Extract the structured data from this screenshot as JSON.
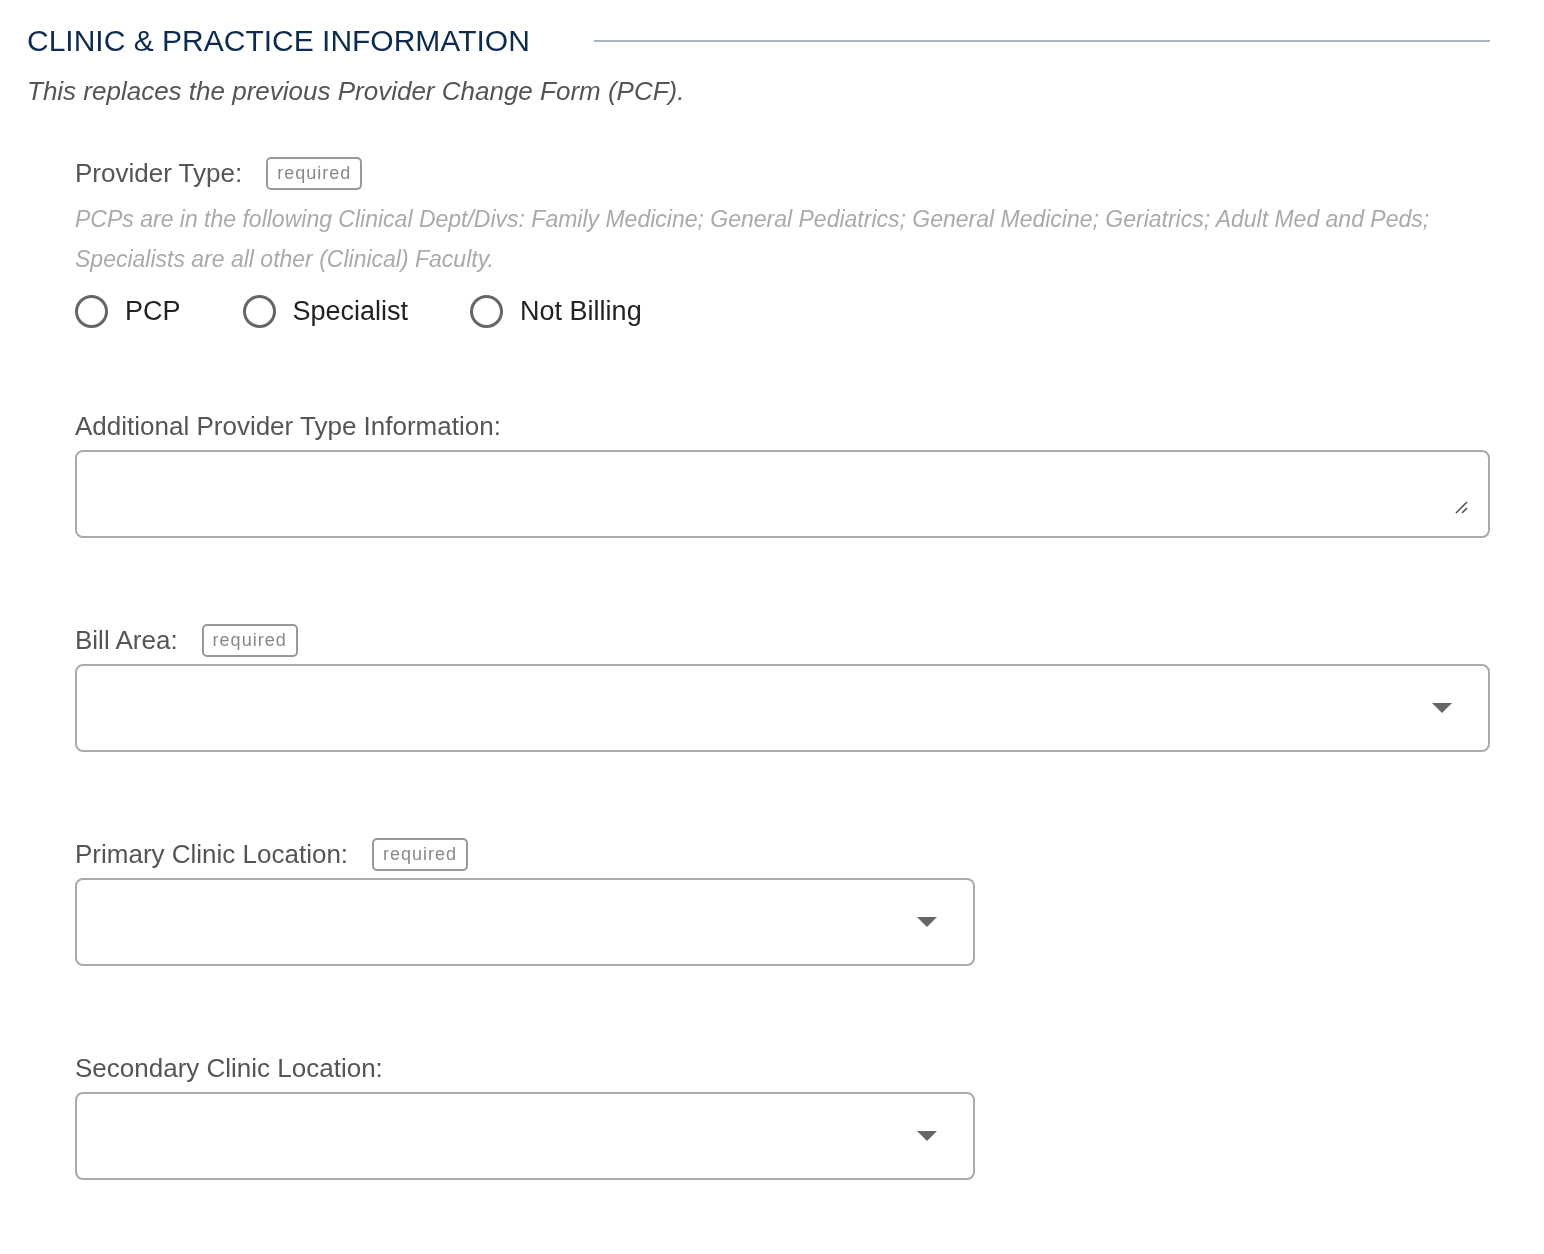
{
  "section": {
    "title": "CLINIC & PRACTICE INFORMATION",
    "subtitle": "This replaces the previous Provider Change Form (PCF)."
  },
  "fields": [
    {
      "kind": "radio",
      "label": "Provider Type:",
      "badge": "required",
      "help": "PCPs are in the following Clinical Dept/Divs: Family Medicine; General Pediatrics; General Medicine; Geriatrics; Adult Med and Peds; Specialists are all other (Clinical) Faculty.",
      "options": [
        {
          "label": "PCP",
          "selected": false
        },
        {
          "label": "Specialist",
          "selected": false
        },
        {
          "label": "Not Billing",
          "selected": false
        }
      ]
    },
    {
      "kind": "textarea",
      "label": "Additional Provider Type Information:"
    },
    {
      "kind": "select",
      "label": "Bill Area:",
      "badge": "required"
    },
    {
      "kind": "select",
      "label": "Primary Clinic Location:",
      "badge": "required"
    },
    {
      "kind": "select",
      "label": "Secondary Clinic Location:"
    }
  ]
}
